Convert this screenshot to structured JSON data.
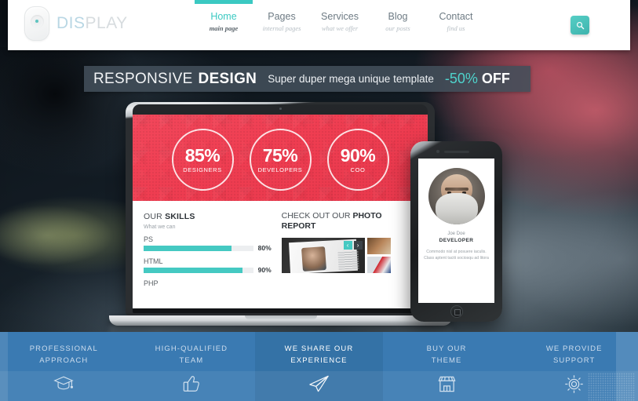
{
  "header": {
    "logo": {
      "part1": "DIS",
      "part2": "PLAY",
      "mark_icon": "oval-logo-icon"
    },
    "nav": [
      {
        "label": "Home",
        "sub": "main page",
        "active": true
      },
      {
        "label": "Pages",
        "sub": "internal pages",
        "active": false
      },
      {
        "label": "Services",
        "sub": "what we offer",
        "active": false
      },
      {
        "label": "Blog",
        "sub": "our posts",
        "active": false
      },
      {
        "label": "Contact",
        "sub": "find us",
        "active": false
      }
    ],
    "search": {
      "icon": "search-icon",
      "label": "Search"
    }
  },
  "ribbon": {
    "word1": "RESPONSIVE",
    "word2": "DESIGN",
    "tagline": "Super duper mega unique template",
    "discount": "-50%",
    "off": "OFF"
  },
  "laptop": {
    "stats": [
      {
        "value": "85%",
        "label": "DESIGNERS"
      },
      {
        "value": "75%",
        "label": "DEVELOPERS"
      },
      {
        "value": "90%",
        "label": "COO"
      }
    ],
    "skills_section": {
      "title_light": "OUR ",
      "title_bold": "SKILLS",
      "subtitle": "What we can",
      "items": [
        {
          "name": "PS",
          "percent": "80%",
          "value": 80
        },
        {
          "name": "HTML",
          "percent": "90%",
          "value": 90
        },
        {
          "name": "PHP",
          "percent": "",
          "value": 0
        }
      ]
    },
    "photo_section": {
      "line1_light": "CHECK OUT OUR ",
      "line1_bold": "PHOTO",
      "line2_bold": "REPORT",
      "prev_icon": "chevron-left-icon",
      "next_icon": "chevron-right-icon",
      "prev_glyph": "‹",
      "next_glyph": "›"
    }
  },
  "phone": {
    "name": "Joe Doe",
    "role": "DEVELOPER",
    "description": "Commodo nisl at posuere iaculis. Class aptent taciti sociosqu ad litora"
  },
  "features": [
    {
      "line1": "PROFESSIONAL",
      "line2": "APPROACH",
      "icon": "graduation-cap-icon",
      "active": false
    },
    {
      "line1": "HIGH-QUALIFIED",
      "line2": "TEAM",
      "icon": "thumbs-up-icon",
      "active": false
    },
    {
      "line1": "WE SHARE OUR",
      "line2": "EXPERIENCE",
      "icon": "paper-plane-icon",
      "active": true
    },
    {
      "line1": "BUY OUR",
      "line2": "THEME",
      "icon": "store-icon",
      "active": false
    },
    {
      "line1": "WE PROVIDE",
      "line2": "SUPPORT",
      "icon": "gear-icon",
      "active": false
    }
  ],
  "colors": {
    "accent_teal": "#3bc9c2",
    "feature_blue": "#3a7ab2",
    "feature_blue_active": "#3472a6",
    "hero_red": "#ef3d51",
    "ribbon_slate": "#424e5a"
  }
}
